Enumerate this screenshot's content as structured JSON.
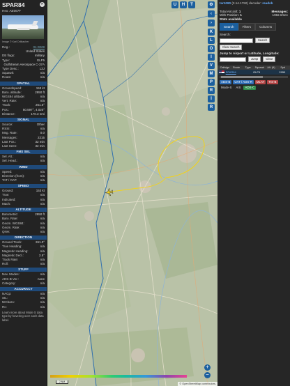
{
  "header": {
    "callsign": "SPAR84",
    "hex_label": "Hex:",
    "hex": "AE067F",
    "photo_credit": "Image © Karl Drilbacher"
  },
  "summary": [
    {
      "k": "Reg.:",
      "v": "01-0029",
      "link": true
    },
    {
      "k": "",
      "v": "United States"
    },
    {
      "k": "DB flags:",
      "v": "military"
    },
    {
      "k": "Type:",
      "v": "GLF5"
    },
    {
      "k": "",
      "v": "Gulfstream Aerospace C-37A"
    },
    {
      "k": "Type Desc.:",
      "v": "L2J"
    },
    {
      "k": "Squawk:",
      "v": "n/a"
    },
    {
      "k": "Route:",
      "v": "n/a"
    }
  ],
  "sections": [
    {
      "title": "SPATIAL",
      "rows": [
        {
          "k": "Groundspeed:",
          "v": "153 kt"
        },
        {
          "k": "Baro. altitude:",
          "v": "2950 ft"
        },
        {
          "k": "WGS84 altitude:",
          "v": "n/a"
        },
        {
          "k": "Vert. Rate:",
          "v": "n/a"
        },
        {
          "k": "Track:",
          "v": "261.0°"
        },
        {
          "k": "Pos.:",
          "v": "50.597°, 4.020°"
        },
        {
          "k": "Distance:",
          "v": "170.3 nmi"
        }
      ]
    },
    {
      "title": "SIGNAL",
      "rows": [
        {
          "k": "Source:",
          "v": "Other"
        },
        {
          "k": "RSSI:",
          "v": "n/a"
        },
        {
          "k": "Msg. Rate:",
          "v": "0.0"
        },
        {
          "k": "Messages:",
          "v": "2215"
        },
        {
          "k": "Last Pos.:",
          "v": "32 min"
        },
        {
          "k": "Last Seen:",
          "v": "32 min"
        }
      ]
    },
    {
      "title": "FMS SEL",
      "rows": [
        {
          "k": "Sel. Alt.:",
          "v": "n/a"
        },
        {
          "k": "Sel. Head.:",
          "v": "n/a"
        }
      ]
    },
    {
      "title": "WIND",
      "rows": [
        {
          "k": "Speed:",
          "v": "n/a"
        },
        {
          "k": "Direction (from):",
          "v": "n/a"
        },
        {
          "k": "TAT / OAT:",
          "v": "n/a"
        }
      ]
    },
    {
      "title": "SPEED",
      "rows": [
        {
          "k": "Ground:",
          "v": "153 kt"
        },
        {
          "k": "True:",
          "v": "n/a"
        },
        {
          "k": "Indicated:",
          "v": "n/a"
        },
        {
          "k": "Mach:",
          "v": "n/a"
        }
      ]
    },
    {
      "title": "ALTITUDE",
      "rows": [
        {
          "k": "Barometric:",
          "v": "2950 ft"
        },
        {
          "k": "Baro. Rate:",
          "v": "n/a"
        },
        {
          "k": "Geom. WGS84:",
          "v": "n/a"
        },
        {
          "k": "Geom. Rate:",
          "v": "n/a"
        },
        {
          "k": "QNH:",
          "v": "n/a"
        }
      ]
    },
    {
      "title": "DIRECTION",
      "rows": [
        {
          "k": "Ground Track:",
          "v": "261.0°"
        },
        {
          "k": "True Heading:",
          "v": "n/a"
        },
        {
          "k": "Magnetic Heading:",
          "v": "n/a"
        },
        {
          "k": "Magnetic Decl.:",
          "v": "2.5°"
        },
        {
          "k": "Track Rate:",
          "v": "n/a"
        },
        {
          "k": "Roll:",
          "v": "n/a"
        }
      ]
    },
    {
      "title": "STUFF",
      "rows": [
        {
          "k": "Nav. Modes:",
          "v": "n/a"
        },
        {
          "k": "ADS-B Ver.:",
          "v": "none"
        },
        {
          "k": "Category:",
          "v": "n/a"
        }
      ]
    },
    {
      "title": "ACCURACY",
      "rows": [
        {
          "k": "NACp:",
          "v": "n/a"
        },
        {
          "k": "SIL:",
          "v": "n/a"
        },
        {
          "k": "NICbaro:",
          "v": "n/a"
        },
        {
          "k": "Rc:",
          "v": "n/a"
        }
      ]
    }
  ],
  "accuracy_note": "Learn more about Mode S data type by hovering over each data label.",
  "map": {
    "top_buttons": [
      "U",
      "H",
      "T"
    ],
    "side_buttons": [
      "K",
      "L",
      "O",
      "I",
      "V",
      "M",
      "P",
      "R",
      "Ⅰ",
      "R"
    ],
    "scale_label": "2 NM",
    "attribution": "© OpenStreetMap contributors.",
    "colors": {
      "trail": "#f2d21b",
      "boundary": "#2f6fb0",
      "aircraft": "#f2d21b"
    }
  },
  "right": {
    "version_link": "tar1090",
    "version_text": "(3.14.1792) decoder:",
    "decoder": "readsb",
    "stats": {
      "total_label": "Total Aircraft:",
      "total": "1",
      "messages_label": "Messages:",
      "messages": "1982.6/sec",
      "with_pos_label": "With Position:",
      "with_pos": "1",
      "stats_label": "Stats available"
    },
    "tabs": [
      "Search",
      "Filters",
      "Columns"
    ],
    "search_label": "Search:",
    "search_button": "Search",
    "clear_search_button": "Clear Search",
    "jump_label": "Jump to Airport or Latitude, Longitude:",
    "jump_button": "Jump",
    "clear_button": "Clear",
    "table": {
      "headers": [
        "Callsign",
        "Route",
        "Type",
        "Squawk",
        "Alt. (ft)",
        "Spd"
      ],
      "rows": [
        {
          "callsign": "SPAR84",
          "route": "",
          "type": "GLF5",
          "squawk": "",
          "alt": "2950",
          "spd": ""
        }
      ]
    },
    "badges": [
      {
        "label": "ADS-B",
        "color": "blue"
      },
      {
        "label": "UAT / ADS-R",
        "color": "blue"
      },
      {
        "label": "MLAT",
        "color": "red"
      },
      {
        "label": "TIS-B",
        "color": "red"
      },
      {
        "label": "Mode-S",
        "color": "plain"
      },
      {
        "label": "AIS",
        "color": "plain"
      },
      {
        "label": "ADS-C",
        "color": "green"
      }
    ]
  }
}
